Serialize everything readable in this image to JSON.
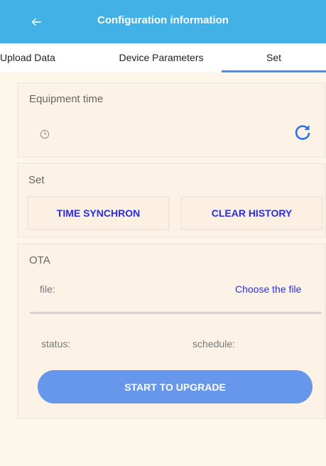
{
  "header": {
    "title": "Configuration information",
    "back_icon": "arrow-left-icon",
    "background_color": "#41b1e6"
  },
  "tabs": [
    {
      "label": "Upload Data",
      "selected": false
    },
    {
      "label": "Device Parameters",
      "selected": false
    },
    {
      "label": "Set",
      "selected": true
    }
  ],
  "equipment_time": {
    "title": "Equipment time",
    "clock_icon": "clock-icon",
    "refresh_icon": "refresh-icon"
  },
  "set_section": {
    "title": "Set",
    "time_sync_label": "TIME SYNCHRON",
    "clear_history_label": "CLEAR HISTORY"
  },
  "ota": {
    "title": "OTA",
    "file_label": "file:",
    "choose_file_label": "Choose the file",
    "status_label": "status:",
    "schedule_label": "schedule:",
    "progress": 0,
    "upgrade_label": "START TO UPGRADE"
  },
  "colors": {
    "accent": "#3f8ff0",
    "link": "#2a2ee0",
    "upgrade_button": "#6697ea",
    "background": "#fdf6ea"
  }
}
